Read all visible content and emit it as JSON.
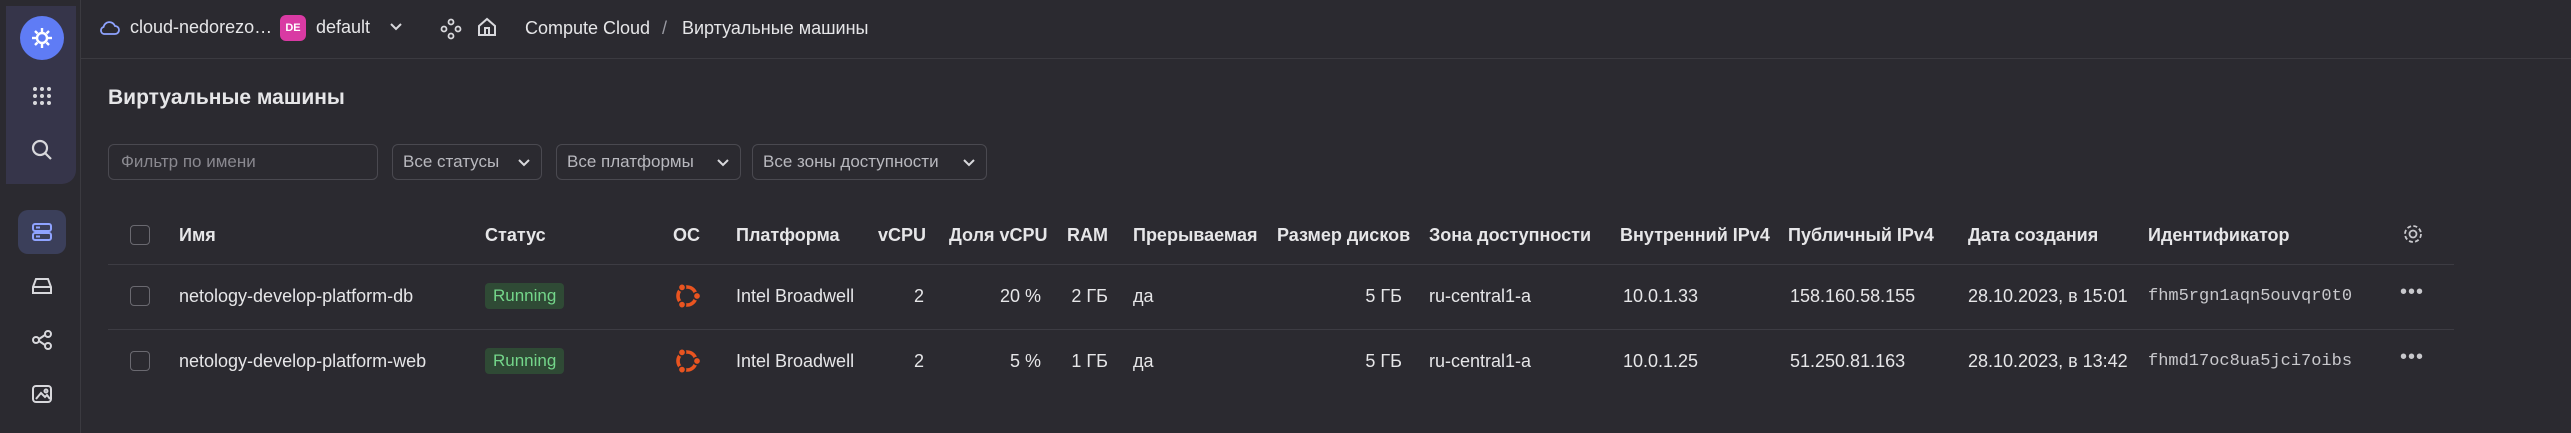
{
  "topbar": {
    "cloud_name": "cloud-nedorezo…",
    "folder_badge": "DE",
    "folder_name": "default",
    "breadcrumb": [
      "Compute Cloud",
      "Виртуальные машины"
    ],
    "separator": "/"
  },
  "page": {
    "title": "Виртуальные машины"
  },
  "filters": {
    "name_placeholder": "Фильтр по имени",
    "status_label": "Все статусы",
    "platform_label": "Все платформы",
    "zone_label": "Все зоны доступности"
  },
  "table": {
    "columns": {
      "name": "Имя",
      "status": "Статус",
      "os": "ОС",
      "platform": "Платформа",
      "vcpu": "vCPU",
      "vcpu_share": "Доля vCPU",
      "ram": "RAM",
      "preemptible": "Прерываемая",
      "disk_size": "Размер дисков",
      "zone": "Зона доступности",
      "internal_ip": "Внутренний IPv4",
      "public_ip": "Публичный IPv4",
      "created": "Дата создания",
      "id": "Идентификатор"
    },
    "rows": [
      {
        "name": "netology-develop-platform-db",
        "status": "Running",
        "platform": "Intel Broadwell",
        "vcpu": "2",
        "vcpu_share": "20 %",
        "ram": "2 ГБ",
        "preemptible": "да",
        "disk_size": "5 ГБ",
        "zone": "ru-central1-a",
        "internal_ip": "10.0.1.33",
        "public_ip": "158.160.58.155",
        "created": "28.10.2023, в 15:01",
        "id": "fhm5rgn1aqn5ouvqr0t0"
      },
      {
        "name": "netology-develop-platform-web",
        "status": "Running",
        "platform": "Intel Broadwell",
        "vcpu": "2",
        "vcpu_share": "5 %",
        "ram": "1 ГБ",
        "preemptible": "да",
        "disk_size": "5 ГБ",
        "zone": "ru-central1-a",
        "internal_ip": "10.0.1.25",
        "public_ip": "51.250.81.163",
        "created": "28.10.2023, в 13:42",
        "id": "fhmd17oc8ua5jci7oibs"
      }
    ]
  },
  "icons": {
    "logo": "gear-logo-icon",
    "apps": "apps-grid-icon",
    "search": "search-icon",
    "compute": "server-icon",
    "storage": "drive-icon",
    "network": "network-icon",
    "images": "image-icon",
    "os": "ubuntu-icon",
    "settings": "gear-icon",
    "more": "more-dots-icon"
  },
  "colors": {
    "background": "#2b2a30",
    "accent": "#5f7cf5",
    "status_running_bg": "#2f4a35",
    "status_running_text": "#74d68a",
    "ubuntu": "#e95420",
    "folder_badge": "#d93aa3"
  }
}
